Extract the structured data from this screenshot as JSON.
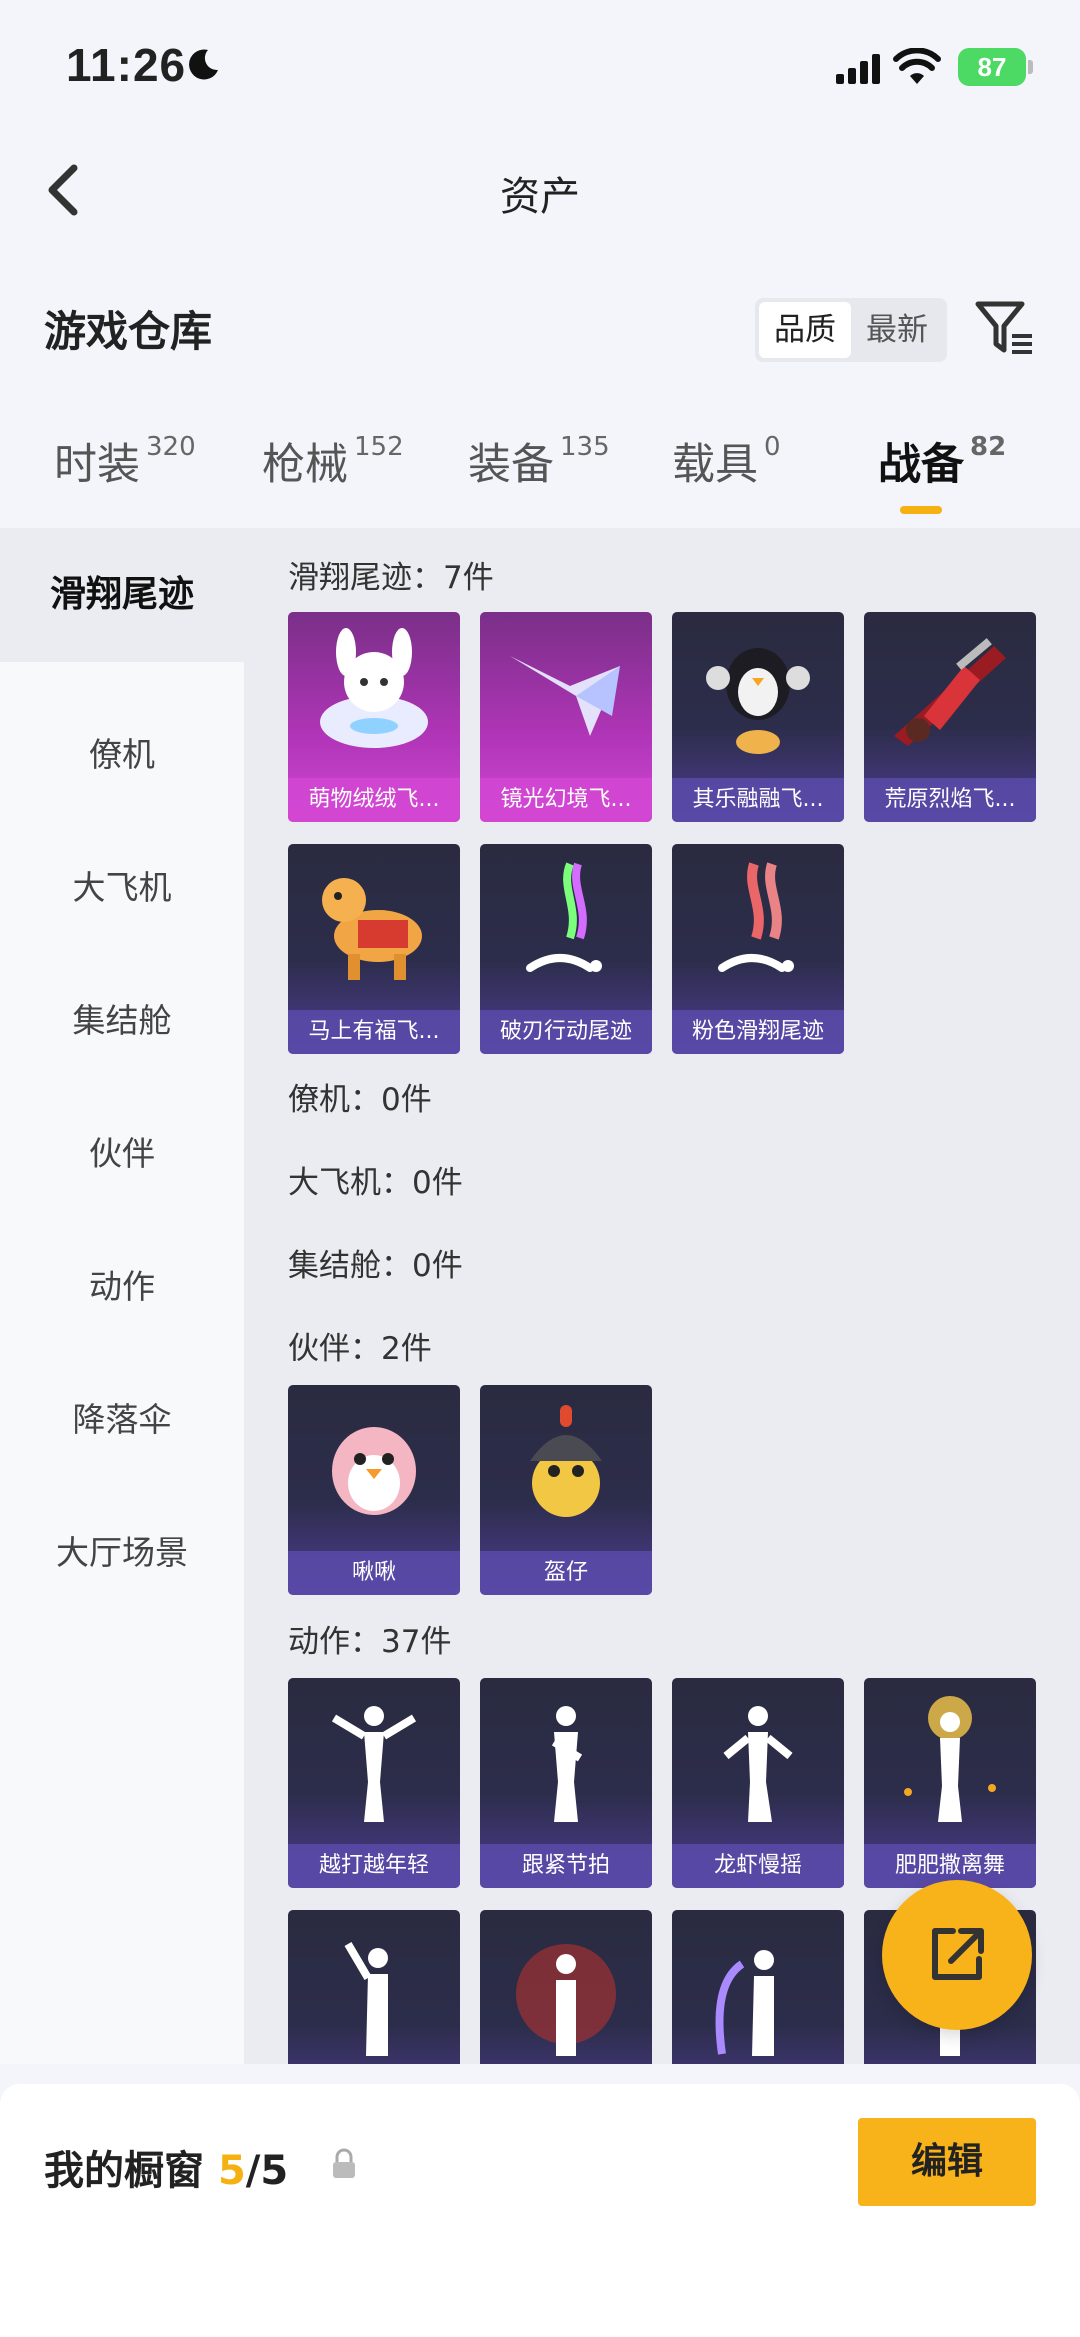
{
  "status_bar": {
    "time": "11:26",
    "battery": "87"
  },
  "header": {
    "title": "资产"
  },
  "section": {
    "title": "游戏仓库",
    "sort_options": [
      "品质",
      "最新"
    ],
    "sort_selected": "品质"
  },
  "tabs": [
    {
      "label": "时装",
      "count": "320"
    },
    {
      "label": "枪械",
      "count": "152"
    },
    {
      "label": "装备",
      "count": "135"
    },
    {
      "label": "载具",
      "count": "0"
    },
    {
      "label": "战备",
      "count": "82",
      "active": true
    }
  ],
  "sidebar": {
    "items": [
      "滑翔尾迹",
      "僚机",
      "大飞机",
      "集结舱",
      "伙伴",
      "动作",
      "降落伞",
      "大厅场景"
    ],
    "active": "滑翔尾迹"
  },
  "groups": {
    "glide": {
      "title": "滑翔尾迹：7件",
      "items": [
        "萌物绒绒飞...",
        "镜光幻境飞...",
        "其乐融融飞...",
        "荒原烈焰飞...",
        "马上有福飞...",
        "破刃行动尾迹",
        "粉色滑翔尾迹"
      ]
    },
    "wingman": {
      "title": "僚机：0件"
    },
    "plane": {
      "title": "大飞机：0件"
    },
    "pod": {
      "title": "集结舱：0件"
    },
    "partner": {
      "title": "伙伴：2件",
      "items": [
        "啾啾",
        "盔仔"
      ]
    },
    "action": {
      "title": "动作：37件",
      "items": [
        "越打越年轻",
        "跟紧节拍",
        "龙虾慢摇",
        "肥肥撒离舞"
      ]
    }
  },
  "bottom_bar": {
    "title": "我的橱窗",
    "current": "5",
    "total": "/5",
    "edit_label": "编辑"
  },
  "colors": {
    "accent": "#f8b21a",
    "card_bg": "#2c2d4b",
    "card_label": "#5a4baa",
    "rare_card": "#b135b8"
  }
}
